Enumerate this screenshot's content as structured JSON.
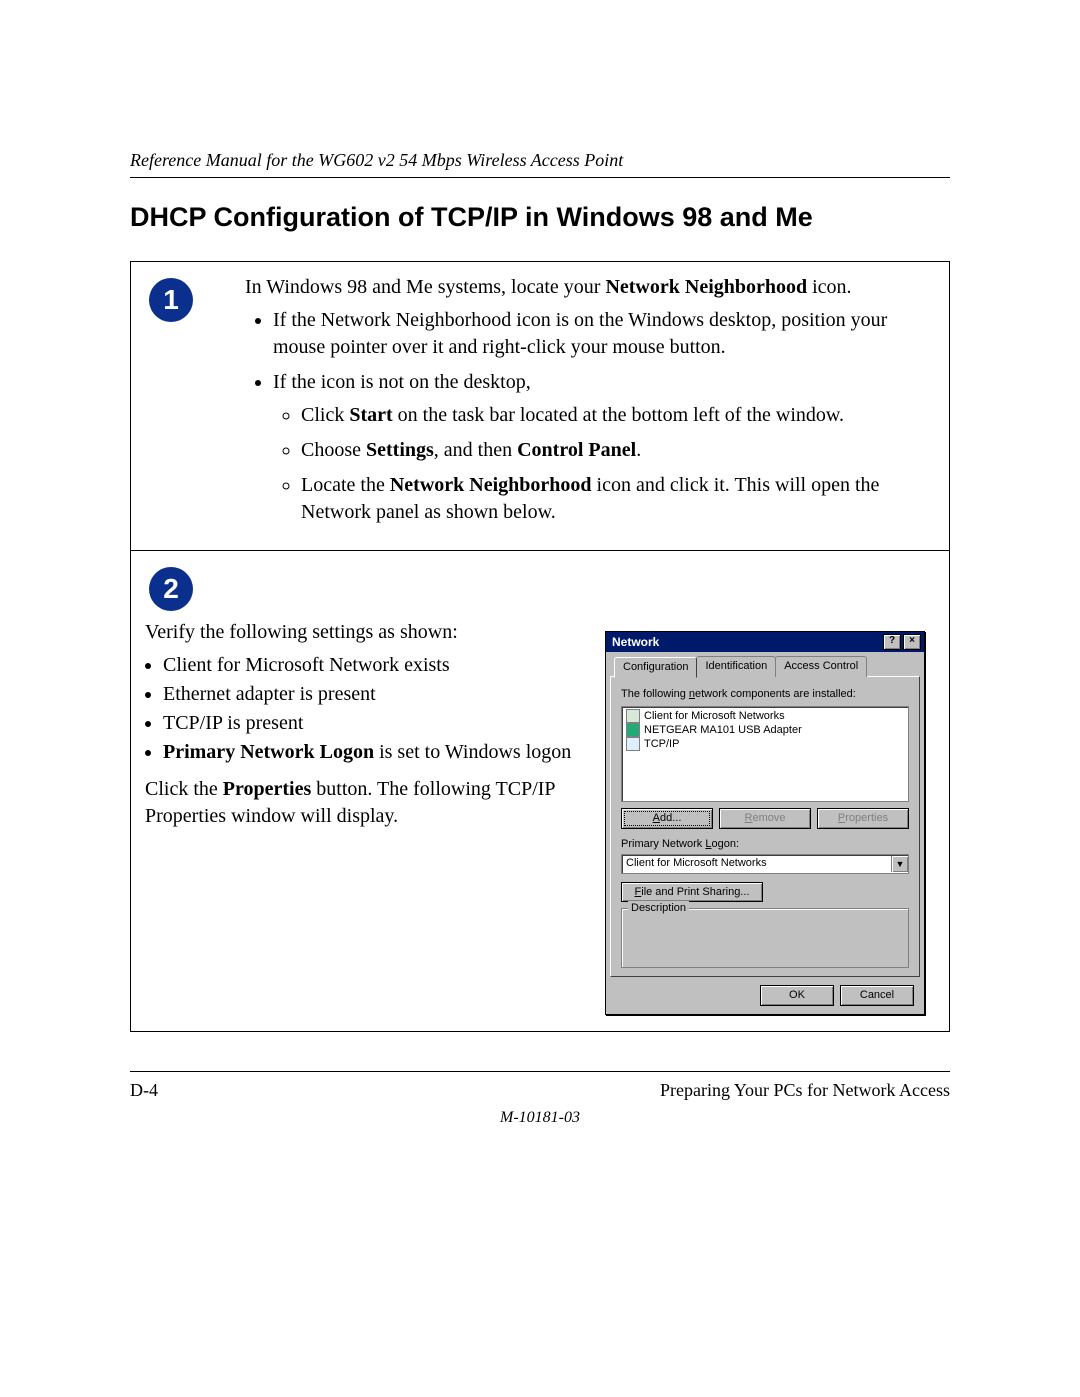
{
  "header": {
    "running": "Reference Manual for the WG602 v2 54 Mbps Wireless Access Point"
  },
  "title": "DHCP Configuration of TCP/IP in Windows 98 and Me",
  "step1": {
    "badge": "1",
    "intro_pre": "In Windows 98 and Me systems, locate your ",
    "intro_bold": "Network Neighborhood",
    "intro_post": " icon.",
    "b1": "If the Network Neighborhood icon is on the Windows desktop, position your mouse pointer over it and right-click your mouse button.",
    "b2": "If the icon is not on the desktop,",
    "s1_pre": "Click ",
    "s1_bold": "Start",
    "s1_post": " on the task bar located at the bottom left of the window.",
    "s2_pre": "Choose ",
    "s2_b1": "Settings",
    "s2_mid": ", and then ",
    "s2_b2": "Control Panel",
    "s2_post": ".",
    "s3_pre": "Locate the ",
    "s3_bold": "Network Neighborhood",
    "s3_post": " icon and click it. This will open the Network panel as shown below."
  },
  "step2": {
    "badge": "2",
    "verify_intro": "Verify the following settings as shown:",
    "v1": "Client for Microsoft Network exists",
    "v2": "Ethernet adapter is present",
    "v3": "TCP/IP is present",
    "v4_bold": "Primary Network Logon",
    "v4_post": " is set to Windows logon",
    "click_pre": "Click the ",
    "click_bold": "Properties",
    "click_post": " button. The following TCP/IP Properties window will display."
  },
  "dialog": {
    "title": "Network",
    "help": "?",
    "close": "×",
    "tabs": {
      "t1": "Configuration",
      "t2": "Identification",
      "t3": "Access Control"
    },
    "list_label_pre": "The following ",
    "list_label_u": "n",
    "list_label_post": "etwork components are installed:",
    "items": {
      "i1": "Client for Microsoft Networks",
      "i2": "NETGEAR MA101 USB Adapter",
      "i3": "TCP/IP"
    },
    "btn_add_u": "A",
    "btn_add": "dd...",
    "btn_remove_u": "R",
    "btn_remove": "emove",
    "btn_props_u": "P",
    "btn_props": "roperties",
    "logon_label_pre": "Primary Network ",
    "logon_label_u": "L",
    "logon_label_post": "ogon:",
    "logon_value": "Client for Microsoft Networks",
    "fps_u": "F",
    "fps": "ile and Print Sharing...",
    "desc_label": "Description",
    "ok": "OK",
    "cancel": "Cancel",
    "dd": "▼"
  },
  "footer": {
    "left": "D-4",
    "right": "Preparing Your PCs for Network Access",
    "docnum": "M-10181-03"
  }
}
